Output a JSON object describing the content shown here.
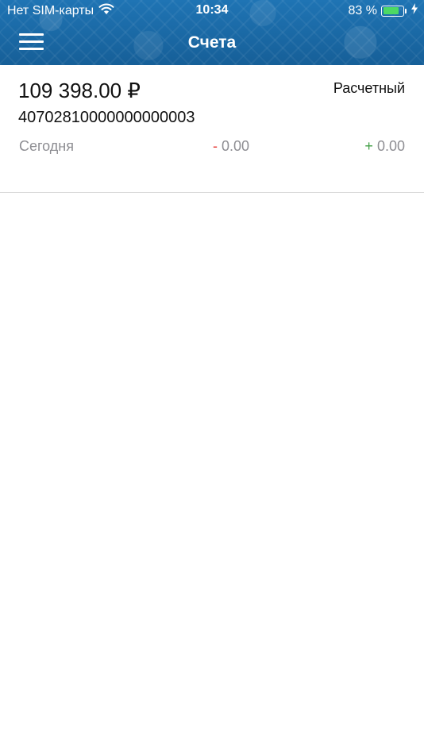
{
  "status_bar": {
    "carrier": "Нет SIM-карты",
    "time": "10:34",
    "battery_text": "83 %",
    "battery_level": 0.83,
    "battery_color": "#4cd964"
  },
  "header": {
    "title": "Счета",
    "menu_icon": "hamburger-menu-icon",
    "background_color": "#1a6aa6"
  },
  "account": {
    "balance": "109 398.00 ₽",
    "type": "Расчетный",
    "number": "40702810000000000003",
    "period": "Сегодня",
    "debit_sign": "-",
    "debit_amount": "0.00",
    "credit_sign": "+",
    "credit_amount": "0.00"
  },
  "colors": {
    "debit": "#e53935",
    "credit": "#43a047",
    "muted_text": "#8e8e93"
  }
}
